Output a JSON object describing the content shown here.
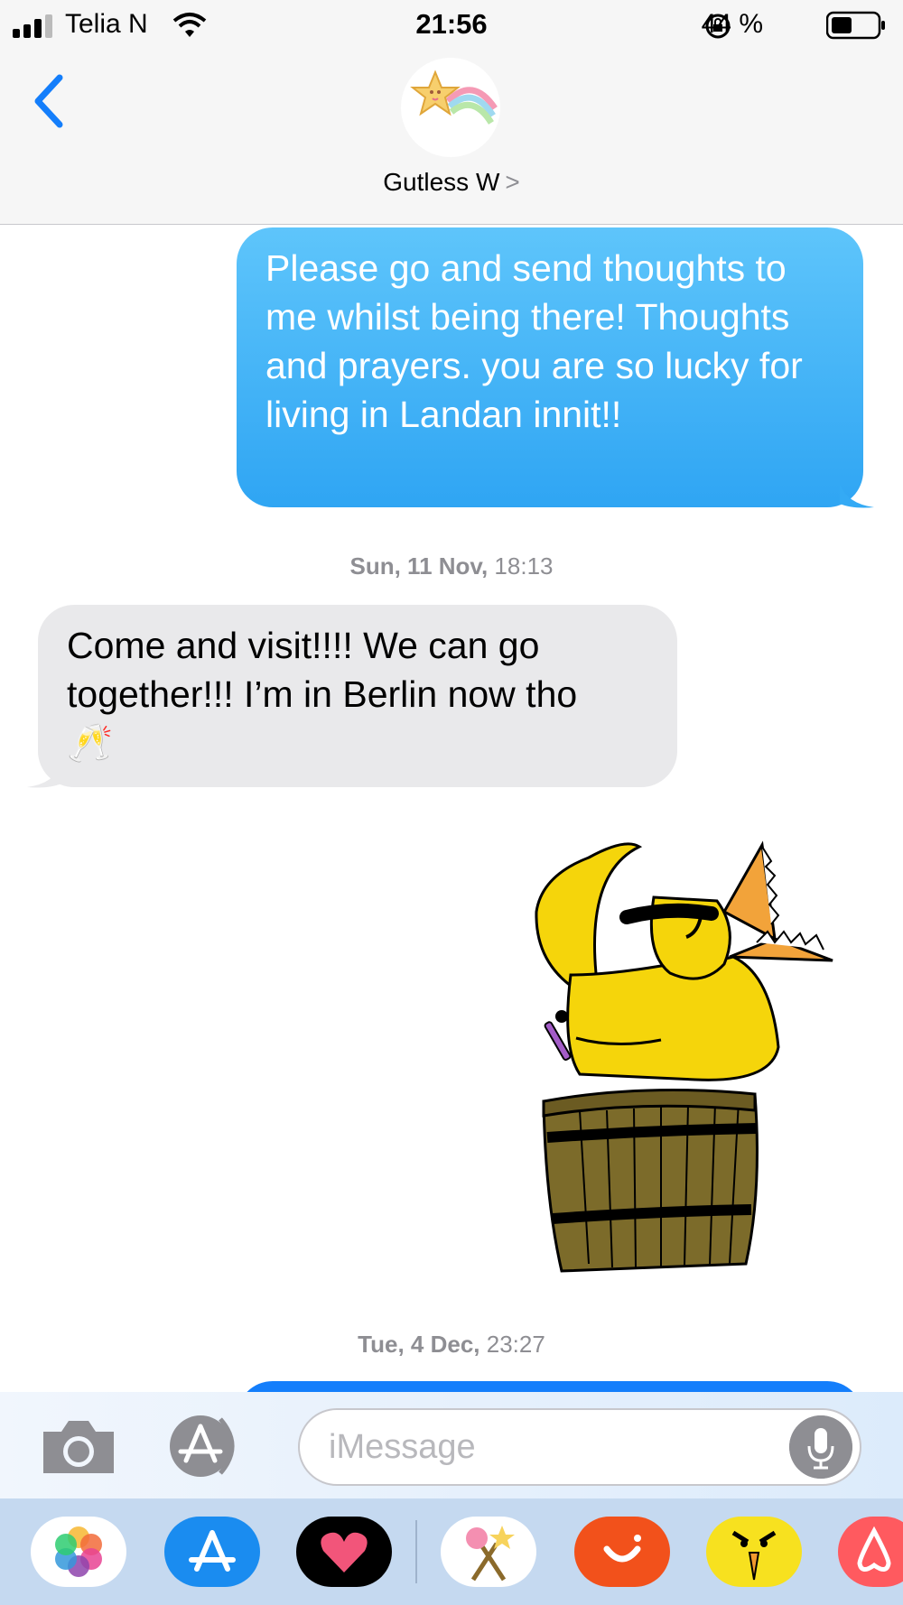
{
  "status_bar": {
    "carrier": "Telia N",
    "time": "21:56",
    "battery": "44 %"
  },
  "header": {
    "contact_name": "Gutless W",
    "chevron": ">"
  },
  "messages": [
    {
      "direction": "outgoing",
      "text": "Please go and send thoughts to me whilst being there! Thoughts and prayers. you are so lucky for living in Landan innit!!"
    },
    {
      "type": "timestamp",
      "day": "Sun, 11 Nov,",
      "time": "18:13"
    },
    {
      "direction": "incoming",
      "text": "Come and visit!!!! We can go together!!! I’m in Berlin now tho",
      "emoji": "🥂"
    },
    {
      "direction": "outgoing",
      "type": "image",
      "description_icon": "yellow-creature-in-barrel-drawing"
    },
    {
      "type": "timestamp",
      "day": "Tue, 4 Dec,",
      "time": "23:27"
    }
  ],
  "input": {
    "placeholder": "iMessage"
  },
  "app_tray": [
    "photos-app-icon",
    "app-store-icon",
    "heart-app-icon",
    "sticker-app-icon",
    "smile-app-icon",
    "bird-app-icon",
    "airbnb-app-icon"
  ],
  "colors": {
    "accent": "#147efb",
    "outgoing_bubble": "#34aaf5",
    "incoming_bubble": "#e9e9eb"
  }
}
